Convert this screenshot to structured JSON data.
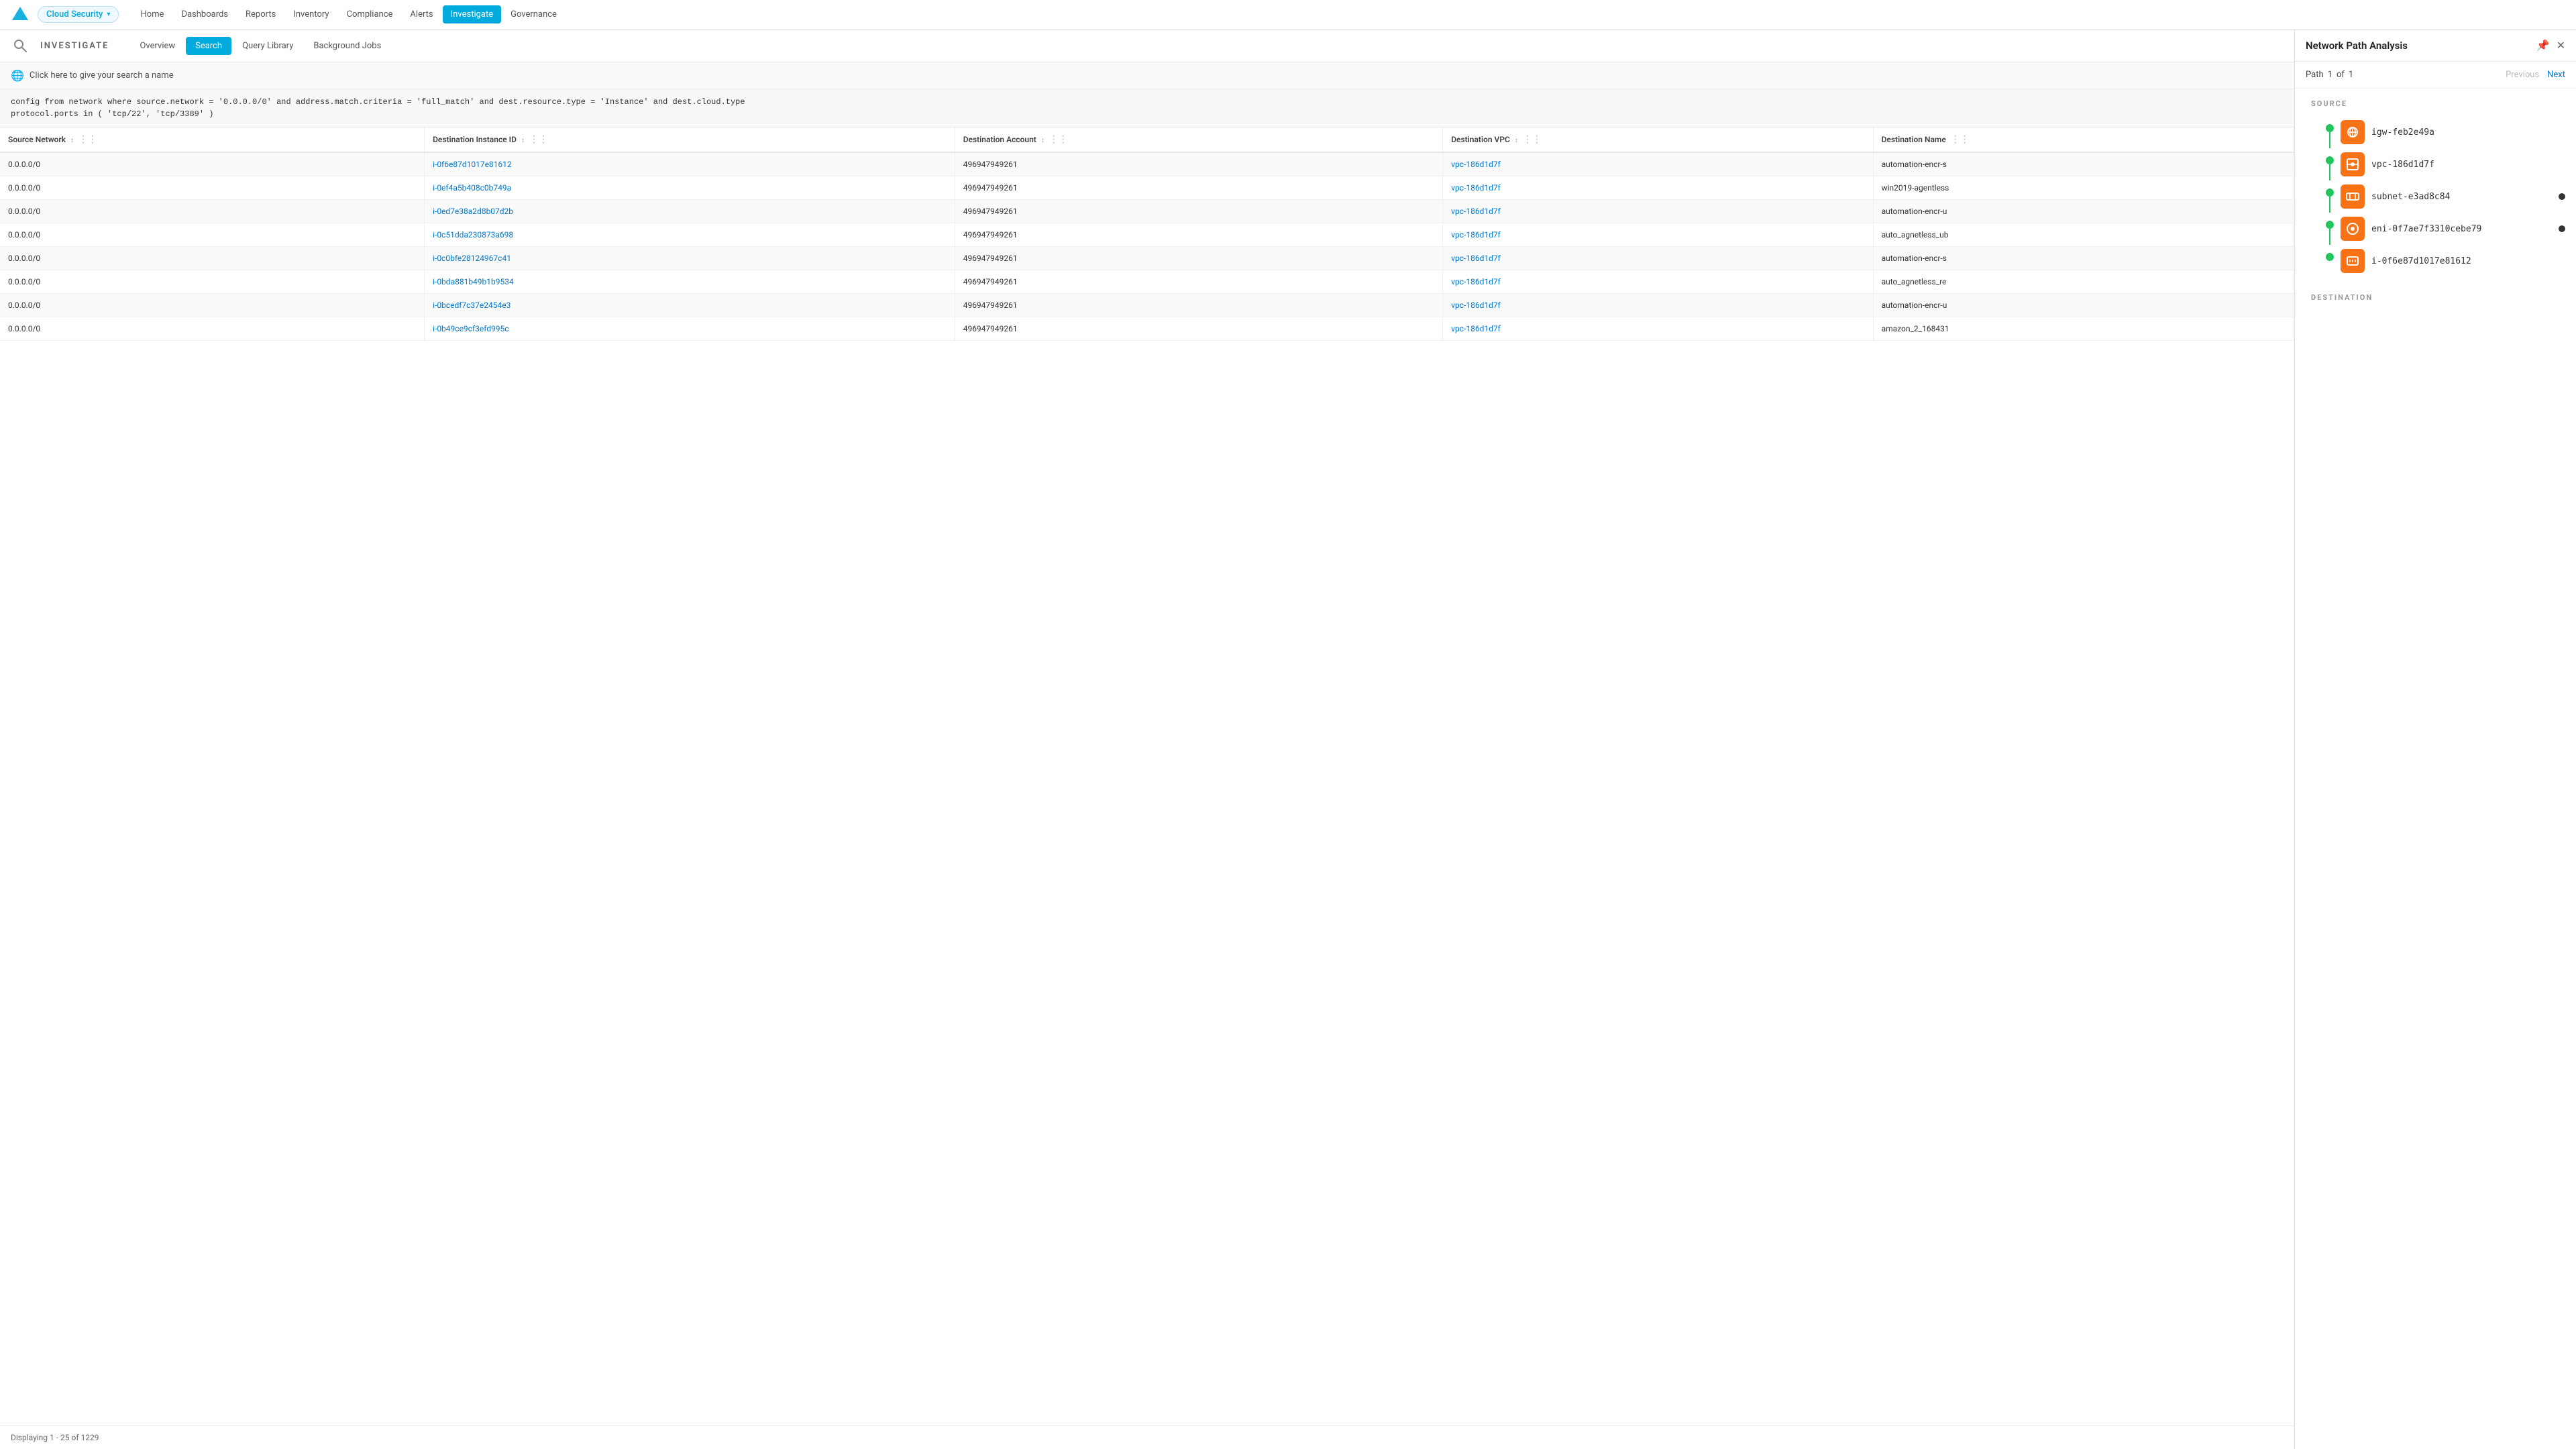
{
  "topNav": {
    "brand": "Cloud Security",
    "chevron": "▾",
    "items": [
      {
        "label": "Home",
        "active": false
      },
      {
        "label": "Dashboards",
        "active": false
      },
      {
        "label": "Reports",
        "active": false
      },
      {
        "label": "Inventory",
        "active": false
      },
      {
        "label": "Compliance",
        "active": false
      },
      {
        "label": "Alerts",
        "active": false
      },
      {
        "label": "Investigate",
        "active": true
      },
      {
        "label": "Governance",
        "active": false
      }
    ]
  },
  "investigate": {
    "title": "INVESTIGATE",
    "tabs": [
      {
        "label": "Overview",
        "active": false
      },
      {
        "label": "Search",
        "active": true
      },
      {
        "label": "Query Library",
        "active": false
      },
      {
        "label": "Background Jobs",
        "active": false
      }
    ]
  },
  "searchNameBar": {
    "text": "Click here to give your search a name"
  },
  "query": {
    "text": "config from network where source.network = '0.0.0.0/0' and address.match.criteria = 'full_match' and dest.resource.type = 'Instance' and dest.cloud.type\nprotocol.ports in ( 'tcp/22', 'tcp/3389' )"
  },
  "table": {
    "columns": [
      {
        "label": "Source Network",
        "key": "sourceNetwork"
      },
      {
        "label": "Destination Instance ID",
        "key": "destInstanceId"
      },
      {
        "label": "Destination Account",
        "key": "destAccount"
      },
      {
        "label": "Destination VPC",
        "key": "destVPC"
      },
      {
        "label": "Destination Name",
        "key": "destName"
      }
    ],
    "rows": [
      {
        "sourceNetwork": "0.0.0.0/0",
        "destInstanceId": "i-0f6e87d1017e81612",
        "destAccount": "496947949261",
        "destVPC": "vpc-186d1d7f",
        "destName": "automation-encr-s"
      },
      {
        "sourceNetwork": "0.0.0.0/0",
        "destInstanceId": "i-0ef4a5b408c0b749a",
        "destAccount": "496947949261",
        "destVPC": "vpc-186d1d7f",
        "destName": "win2019-agentless"
      },
      {
        "sourceNetwork": "0.0.0.0/0",
        "destInstanceId": "i-0ed7e38a2d8b07d2b",
        "destAccount": "496947949261",
        "destVPC": "vpc-186d1d7f",
        "destName": "automation-encr-u"
      },
      {
        "sourceNetwork": "0.0.0.0/0",
        "destInstanceId": "i-0c51dda230873a698",
        "destAccount": "496947949261",
        "destVPC": "vpc-186d1d7f",
        "destName": "auto_agnetless_ub"
      },
      {
        "sourceNetwork": "0.0.0.0/0",
        "destInstanceId": "i-0c0bfe28124967c41",
        "destAccount": "496947949261",
        "destVPC": "vpc-186d1d7f",
        "destName": "automation-encr-s"
      },
      {
        "sourceNetwork": "0.0.0.0/0",
        "destInstanceId": "i-0bda881b49b1b9534",
        "destAccount": "496947949261",
        "destVPC": "vpc-186d1d7f",
        "destName": "auto_agnetless_re"
      },
      {
        "sourceNetwork": "0.0.0.0/0",
        "destInstanceId": "i-0bcedf7c37e2454e3",
        "destAccount": "496947949261",
        "destVPC": "vpc-186d1d7f",
        "destName": "automation-encr-u"
      },
      {
        "sourceNetwork": "0.0.0.0/0",
        "destInstanceId": "i-0b49ce9cf3efd995c",
        "destAccount": "496947949261",
        "destVPC": "vpc-186d1d7f",
        "destName": "amazon_2_168431"
      }
    ],
    "footer": "Displaying 1 - 25 of 1229"
  },
  "rightPanel": {
    "title": "Network Path Analysis",
    "pathLabel": "Path",
    "pathCurrent": "1",
    "pathOf": "of",
    "pathTotal": "1",
    "prevLabel": "Previous",
    "nextLabel": "Next",
    "sourceLabel": "SOURCE",
    "destinationLabel": "DESTINATION",
    "nodes": [
      {
        "id": "igw-feb2e49a",
        "type": "internet",
        "hasExtra": false
      },
      {
        "id": "vpc-186d1d7f",
        "type": "vpc",
        "hasExtra": false
      },
      {
        "id": "subnet-e3ad8c84",
        "type": "subnet",
        "hasExtra": true
      },
      {
        "id": "eni-0f7ae7f3310cebe79",
        "type": "eni",
        "hasExtra": true
      },
      {
        "id": "i-0f6e87d1017e81612",
        "type": "instance",
        "hasExtra": false
      }
    ]
  }
}
